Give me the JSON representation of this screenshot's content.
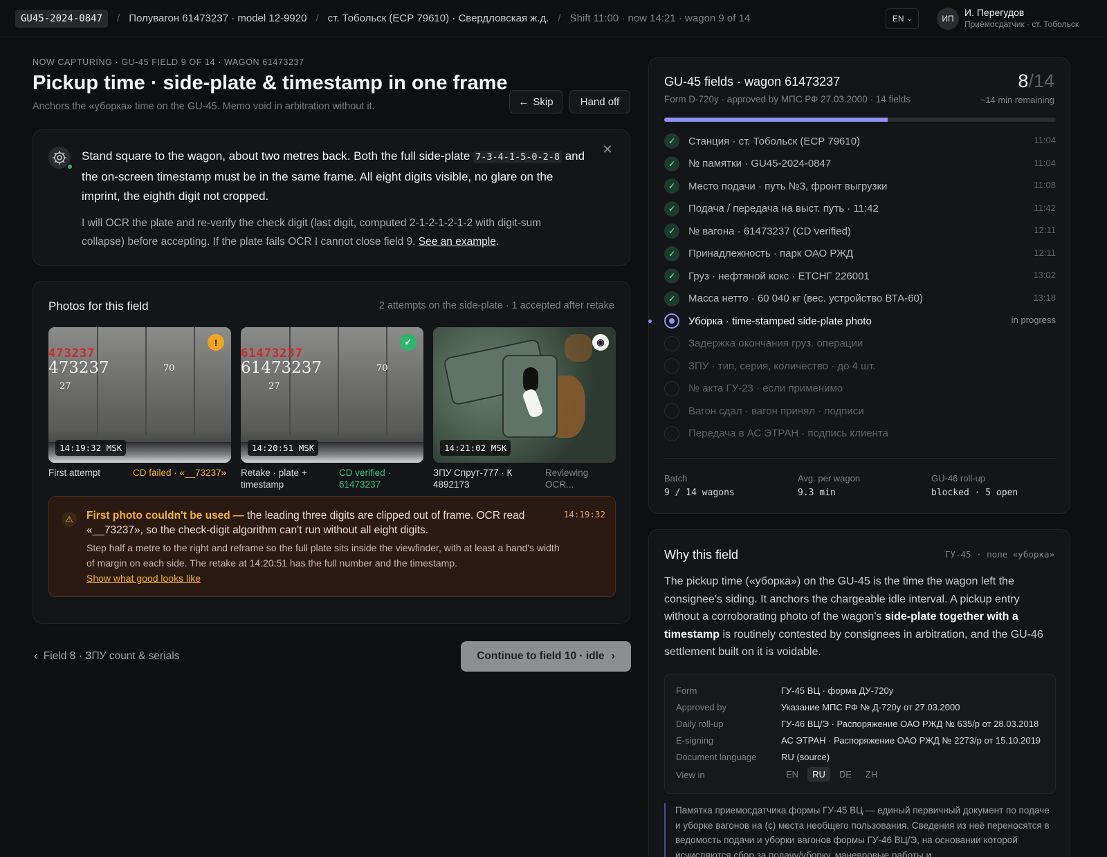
{
  "topbar": {
    "doc_id": "GU45-2024-0847",
    "wagon": "Полувагон 61473237 · model 12-9920",
    "station": "ст. Тобольск (ЕСР 79610) · Свердловская ж.д.",
    "shift": "Shift 11:00 · now 14:21 · wagon 9 of 14",
    "lang": "EN",
    "user_initials": "ИП",
    "user_name": "И. Перегудов",
    "user_role": "Приёмосдатчик · ст. Тобольск"
  },
  "header": {
    "eyebrow": "NOW CAPTURING · GU-45 FIELD 9 OF 14 · WAGON 61473237",
    "title": "Pickup time · side-plate & timestamp in one frame",
    "subtitle": "Anchors the «уборка» time on the GU-45. Memo void in arbitration without it.",
    "skip_label": "Skip",
    "handoff_label": "Hand off"
  },
  "guide": {
    "line1_a": "Stand square to the wagon, about ",
    "line1_bold": "two metres back",
    "line1_b": ". Both the full side-plate ",
    "plate_code": "7-3-4-1-5-0-2-8",
    "line1_c": " and the on-screen timestamp must be in the same frame. All eight digits visible, no glare on the imprint, the eighth digit not cropped.",
    "sub": "I will OCR the plate and re-verify the check digit (last digit, computed 2-1-2-1-2-1-2 with digit-sum collapse) before accepting. If the plate fails OCR I cannot close field 9. ",
    "sub_link": "See an example",
    "sub_end": "."
  },
  "photos": {
    "title": "Photos for this field",
    "meta": "2 attempts on the side-plate · 1 accepted after retake",
    "items": [
      {
        "stamp": "14:19:32 MSK",
        "plate_red": "473237",
        "plate_white": "473237",
        "plate_small_a": "70",
        "plate_small_b": "27",
        "caption": "First attempt",
        "status": "CD failed · «__73237»"
      },
      {
        "stamp": "14:20:51 MSK",
        "plate_red": "61473237",
        "plate_white": "61473237",
        "plate_small_a": "70",
        "plate_small_b": "27",
        "caption": "Retake · plate + timestamp",
        "status": "CD verified · 61473237"
      },
      {
        "stamp": "14:21:02 MSK",
        "caption": "ЗПУ Спрут-777 · К 4892173",
        "status": "Reviewing OCR..."
      }
    ],
    "alert": {
      "head_bold": "First photo couldn't be used —",
      "head_rest": " the leading three digits are clipped out of frame. OCR read «__73237», so the check-digit algorithm can't run without all eight digits.",
      "time": "14:19:32",
      "body": "Step half a metre to the right and reframe so the full plate sits inside the viewfinder, with at least a hand's width of margin on each side. The retake at 14:20:51 has the full number and the timestamp.",
      "link": "Show what good looks like"
    }
  },
  "footer_nav": {
    "prev": "Field 8 · ЗПУ count & serials",
    "next": "Continue to field 10 · idle"
  },
  "progress": {
    "title": "GU-45 fields · wagon 61473237",
    "subtitle": "Form D-720y · approved by МПС РФ 27.03.2000 · 14 fields",
    "done": "8",
    "total": "/14",
    "remaining": "~14 min remaining",
    "fraction": 0.571,
    "fields": [
      {
        "label": "Станция · ст. Тобольск (ЕСР 79610)",
        "time": "11:04",
        "state": "done"
      },
      {
        "label": "№ памятки · GU45-2024-0847",
        "time": "11:04",
        "state": "done"
      },
      {
        "label": "Место подачи · путь №3, фронт выгрузки",
        "time": "11:08",
        "state": "done"
      },
      {
        "label": "Подача / передача на выст. путь · 11:42",
        "time": "11:42",
        "state": "done"
      },
      {
        "label": "№ вагона · 61473237 (CD verified)",
        "time": "12:11",
        "state": "done"
      },
      {
        "label": "Принадлежность · парк ОАО РЖД",
        "time": "12:11",
        "state": "done"
      },
      {
        "label": "Груз · нефтяной кокс · ЕТСНГ 226001",
        "time": "13:02",
        "state": "done"
      },
      {
        "label": "Масса нетто · 60 040 кг (вес. устройство ВТА-60)",
        "time": "13:18",
        "state": "done"
      },
      {
        "label": "Уборка · time-stamped side-plate photo",
        "time": "in progress",
        "state": "current"
      },
      {
        "label": "Задержка окончания груз. операции",
        "time": "",
        "state": "pending"
      },
      {
        "label": "ЗПУ · тип, серия, количество · до 4 шт.",
        "time": "",
        "state": "pending"
      },
      {
        "label": "№ акта ГУ-23 · если применимо",
        "time": "",
        "state": "pending"
      },
      {
        "label": "Вагон сдал · вагон принял · подписи",
        "time": "",
        "state": "pending"
      },
      {
        "label": "Передача в АС ЭТРАН · подпись клиента",
        "time": "",
        "state": "pending"
      }
    ],
    "stats": [
      {
        "label": "Batch",
        "value": "9 / 14 wagons"
      },
      {
        "label": "Avg. per wagon",
        "value": "9.3 min"
      },
      {
        "label": "GU-46 roll-up",
        "value": "blocked · 5 open"
      }
    ]
  },
  "why": {
    "title": "Why this field",
    "tag": "ГУ-45 · поле «уборка»",
    "body_a": "The pickup time («уборка») on the GU-45 is the time the wagon left the consignee's siding. It anchors the chargeable idle interval. A pickup entry without a corroborating photo of the wagon's ",
    "body_bold": "side-plate together with a timestamp",
    "body_b": " is routinely contested by consignees in arbitration, and the GU-46 settlement built on it is voidable.",
    "meta": [
      {
        "k": "Form",
        "v": "ГУ-45 ВЦ · форма ДУ-720у"
      },
      {
        "k": "Approved by",
        "v": "Указание МПС РФ № Д-720у от 27.03.2000"
      },
      {
        "k": "Daily roll-up",
        "v": "ГУ-46 ВЦ/Э · Распоряжение ОАО РЖД № 635/р от 28.03.2018"
      },
      {
        "k": "E-signing",
        "v": "АС ЭТРАН · Распоряжение ОАО РЖД № 2273/р от 15.10.2019"
      },
      {
        "k": "Document language",
        "v": "RU (source)"
      }
    ],
    "view_in_label": "View in",
    "langs": [
      "EN",
      "RU",
      "DE",
      "ZH"
    ],
    "active_lang": "RU",
    "quote": "Памятка приемосдатчика формы ГУ-45 ВЦ — единый первичный документ по подаче и уборке вагонов на (с) места необщего пользования. Сведения из неё переносятся в ведомость подачи и уборки вагонов формы ГУ-46 ВЦ/Э, на основании которой исчисляются сбор за подачу/уборку, маневровые работы и"
  }
}
